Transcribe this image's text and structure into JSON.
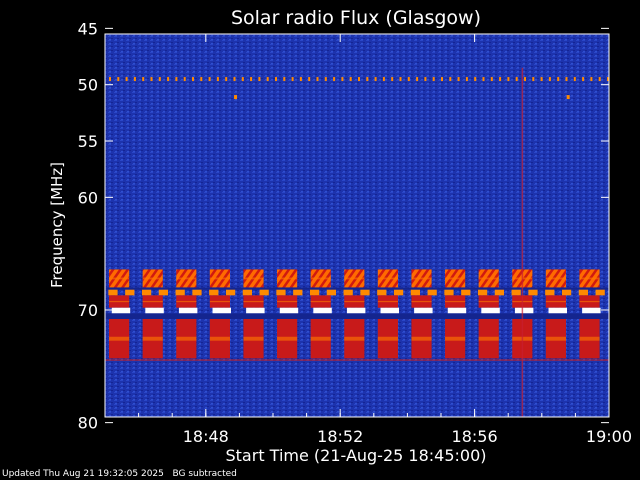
{
  "chart_data": {
    "type": "heatmap",
    "title": "Solar radio Flux (Glasgow)",
    "xlabel": "Start Time (21-Aug-25 18:45:00)",
    "ylabel": "Frequency [MHz]",
    "x_range_minutes": [
      0,
      15
    ],
    "x_ticks": [
      {
        "minute": 3,
        "label": "18:48"
      },
      {
        "minute": 7,
        "label": "18:52"
      },
      {
        "minute": 11,
        "label": "18:56"
      },
      {
        "minute": 15,
        "label": "19:00"
      }
    ],
    "y_range_mhz": [
      45,
      80
    ],
    "y_axis_inverted": true,
    "y_ticks": [
      {
        "mhz": 45,
        "label": "45"
      },
      {
        "mhz": 50,
        "label": "50"
      },
      {
        "mhz": 55,
        "label": "55"
      },
      {
        "mhz": 60,
        "label": "60"
      },
      {
        "mhz": 70,
        "label": "70"
      },
      {
        "mhz": 80,
        "label": "80"
      }
    ],
    "background_color": "#1a2fa8",
    "colors": {
      "low": "#1a2fa8",
      "mid": "#c81a1a",
      "high": "#ff8a00",
      "max": "#ffffff"
    },
    "bands": [
      {
        "mhz_from": 66.4,
        "mhz_to": 68.0,
        "level": "high",
        "pattern": "bursts",
        "cycles": 15
      },
      {
        "mhz_from": 68.0,
        "mhz_to": 68.2,
        "level": "low",
        "pattern": "solid"
      },
      {
        "mhz_from": 68.2,
        "mhz_to": 68.7,
        "level": "high",
        "pattern": "dashes",
        "cycles": 30
      },
      {
        "mhz_from": 68.7,
        "mhz_to": 69.8,
        "level": "mid",
        "pattern": "bursts",
        "cycles": 15
      },
      {
        "mhz_from": 69.8,
        "mhz_to": 70.3,
        "level": "max",
        "pattern": "dashes",
        "cycles": 15
      },
      {
        "mhz_from": 70.3,
        "mhz_to": 70.8,
        "level": "low",
        "pattern": "solid"
      },
      {
        "mhz_from": 70.8,
        "mhz_to": 74.3,
        "level": "mid",
        "pattern": "bursts",
        "cycles": 15
      }
    ],
    "lines": [
      {
        "mhz": 49.5,
        "level": "high",
        "pattern": "dots",
        "count": 60
      },
      {
        "mhz": 74.4,
        "level": "mid",
        "pattern": "solid"
      }
    ],
    "markers": [
      {
        "minute": 3.9,
        "mhz": 51.1,
        "level": "high"
      },
      {
        "minute": 13.8,
        "mhz": 51.1,
        "level": "high"
      }
    ],
    "spike_minute": 12.4
  },
  "footer": {
    "updated": "Updated Thu Aug 21 19:32:05 2025",
    "note": "BG subtracted"
  }
}
